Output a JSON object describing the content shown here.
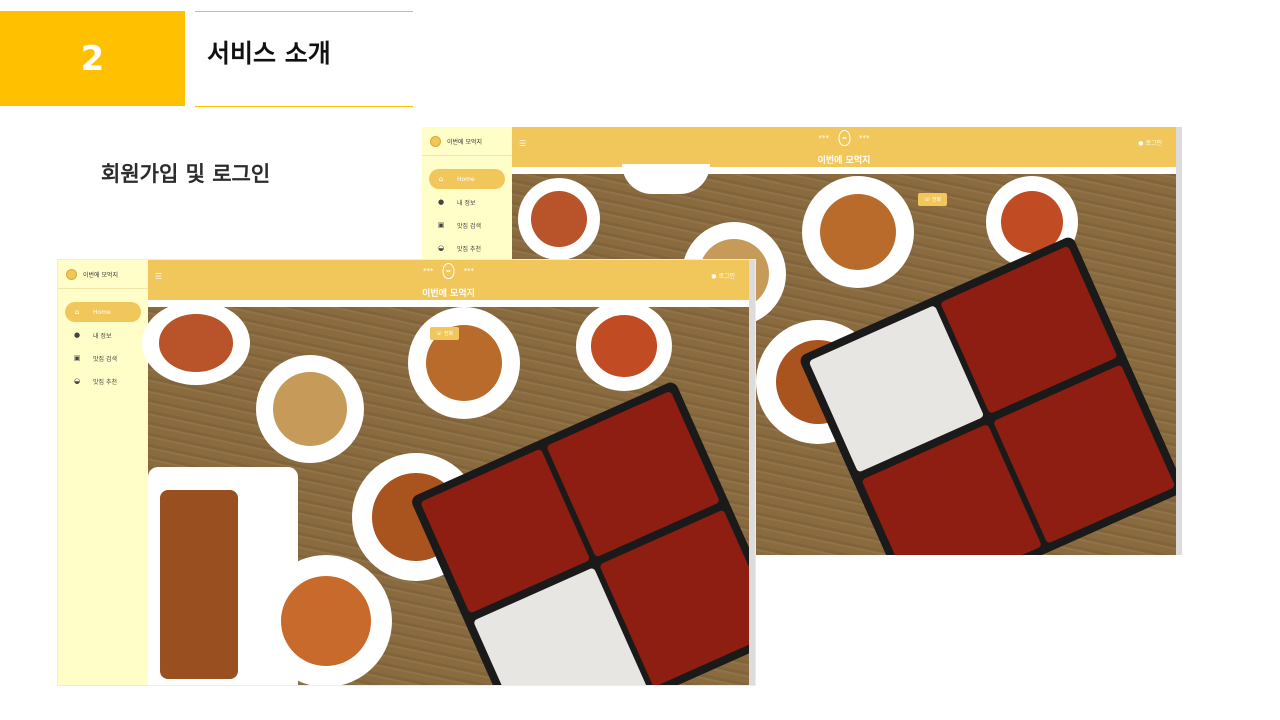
{
  "slide": {
    "number": "2",
    "title": "서비스 소개",
    "subtitle": "회원가입 및 로그인"
  },
  "app": {
    "brand": "이번에 모먹지",
    "site_name": "이번에 모먹지",
    "header_deco": "***",
    "login_label": "로그인",
    "call_label": "전화",
    "nav": [
      {
        "label": "Home",
        "icon": "home-icon",
        "active": true
      },
      {
        "label": "내 정보",
        "icon": "user-icon",
        "active": false
      },
      {
        "label": "맛집 검색",
        "icon": "search-icon",
        "active": false
      },
      {
        "label": "맛집 추천",
        "icon": "bowl-icon",
        "active": false
      }
    ]
  },
  "colors": {
    "accent": "#FFC000",
    "app_yellow": "#F1C75B",
    "sidebar_bg": "#FFFDC8"
  }
}
